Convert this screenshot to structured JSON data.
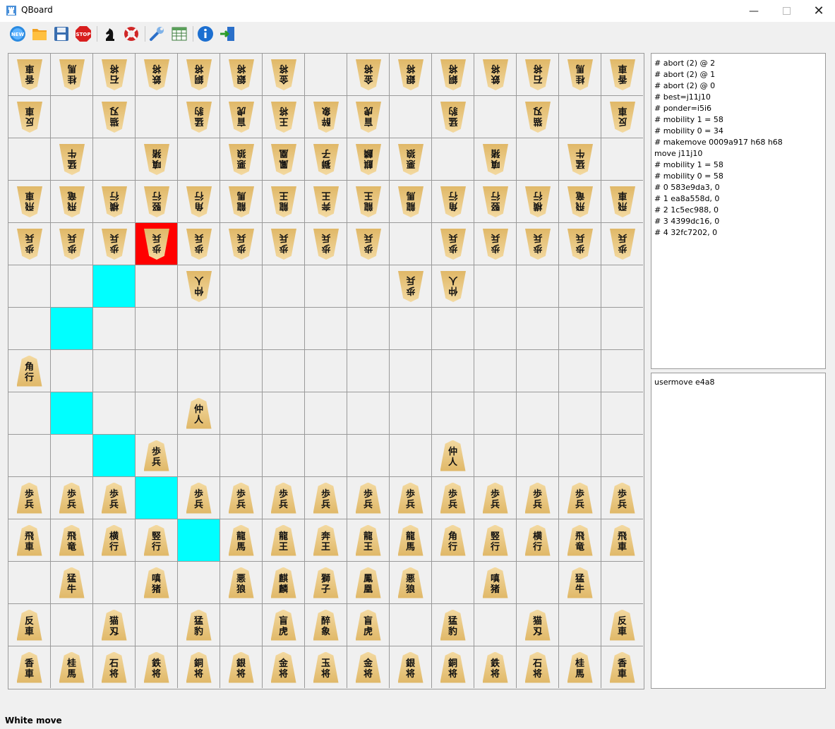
{
  "window": {
    "title": "QBoard"
  },
  "toolbar": {
    "buttons": [
      {
        "name": "new-game-button",
        "icon": "new-icon",
        "label": "NEW"
      },
      {
        "name": "open-button",
        "icon": "folder-icon"
      },
      {
        "name": "save-button",
        "icon": "floppy-icon"
      },
      {
        "name": "stop-button",
        "icon": "stop-icon",
        "label": "STOP"
      },
      {
        "name": "engine-button",
        "icon": "chess-knight-icon"
      },
      {
        "name": "help-button",
        "icon": "lifebuoy-icon"
      },
      {
        "name": "settings-button",
        "icon": "wrench-icon"
      },
      {
        "name": "table-button",
        "icon": "table-icon"
      },
      {
        "name": "about-button",
        "icon": "info-icon"
      },
      {
        "name": "exit-button",
        "icon": "exit-icon"
      }
    ]
  },
  "board": {
    "size": 15,
    "rows": [
      [
        [
          "香",
          "車",
          1
        ],
        [
          "桂",
          "馬",
          1
        ],
        [
          "石",
          "将",
          1
        ],
        [
          "鉄",
          "将",
          1
        ],
        [
          "銅",
          "将",
          1
        ],
        [
          "銀",
          "将",
          1
        ],
        [
          "金",
          "将",
          1
        ],
        null,
        [
          "金",
          "将",
          1
        ],
        [
          "銀",
          "将",
          1
        ],
        [
          "銅",
          "将",
          1
        ],
        [
          "鉄",
          "将",
          1
        ],
        [
          "石",
          "将",
          1
        ],
        [
          "桂",
          "馬",
          1
        ],
        [
          "香",
          "車",
          1
        ]
      ],
      [
        [
          "反",
          "車",
          1
        ],
        null,
        [
          "猫",
          "刄",
          1
        ],
        null,
        [
          "猛",
          "豹",
          1
        ],
        [
          "盲",
          "虎",
          1
        ],
        [
          "王",
          "将",
          1
        ],
        [
          "醉",
          "象",
          1
        ],
        [
          "盲",
          "虎",
          1
        ],
        null,
        [
          "猛",
          "豹",
          1
        ],
        null,
        [
          "猫",
          "刄",
          1
        ],
        null,
        [
          "反",
          "車",
          1
        ]
      ],
      [
        null,
        [
          "猛",
          "牛",
          1
        ],
        null,
        [
          "嗔",
          "猪",
          1
        ],
        null,
        [
          "悪",
          "狼",
          1
        ],
        [
          "鳳",
          "凰",
          1
        ],
        [
          "獅",
          "子",
          1
        ],
        [
          "麒",
          "麟",
          1
        ],
        [
          "悪",
          "狼",
          1
        ],
        null,
        [
          "嗔",
          "猪",
          1
        ],
        null,
        [
          "猛",
          "牛",
          1
        ],
        null
      ],
      [
        [
          "飛",
          "車",
          1
        ],
        [
          "飛",
          "竜",
          1
        ],
        [
          "横",
          "行",
          1
        ],
        [
          "竪",
          "行",
          1
        ],
        [
          "角",
          "行",
          1
        ],
        [
          "龍",
          "馬",
          1
        ],
        [
          "龍",
          "王",
          1
        ],
        [
          "奔",
          "王",
          1
        ],
        [
          "龍",
          "王",
          1
        ],
        [
          "龍",
          "馬",
          1
        ],
        [
          "角",
          "行",
          1
        ],
        [
          "竪",
          "行",
          1
        ],
        [
          "横",
          "行",
          1
        ],
        [
          "飛",
          "竜",
          1
        ],
        [
          "飛",
          "車",
          1
        ]
      ],
      [
        [
          "歩",
          "兵",
          1
        ],
        [
          "歩",
          "兵",
          1
        ],
        [
          "歩",
          "兵",
          1
        ],
        [
          "歩",
          "兵",
          1
        ],
        [
          "歩",
          "兵",
          1
        ],
        [
          "歩",
          "兵",
          1
        ],
        [
          "歩",
          "兵",
          1
        ],
        [
          "歩",
          "兵",
          1
        ],
        [
          "歩",
          "兵",
          1
        ],
        null,
        [
          "歩",
          "兵",
          1
        ],
        [
          "歩",
          "兵",
          1
        ],
        [
          "歩",
          "兵",
          1
        ],
        [
          "歩",
          "兵",
          1
        ],
        [
          "歩",
          "兵",
          1
        ]
      ],
      [
        null,
        null,
        null,
        null,
        [
          "仲",
          "人",
          1
        ],
        null,
        null,
        null,
        null,
        [
          "歩",
          "兵",
          1
        ],
        [
          "仲",
          "人",
          1
        ],
        null,
        null,
        null,
        null
      ],
      [
        null,
        null,
        null,
        null,
        null,
        null,
        null,
        null,
        null,
        null,
        null,
        null,
        null,
        null,
        null
      ],
      [
        [
          "角",
          "行",
          0
        ],
        null,
        null,
        null,
        null,
        null,
        null,
        null,
        null,
        null,
        null,
        null,
        null,
        null,
        null
      ],
      [
        null,
        null,
        null,
        null,
        [
          "仲",
          "人",
          0
        ],
        null,
        null,
        null,
        null,
        null,
        null,
        null,
        null,
        null,
        null
      ],
      [
        null,
        null,
        null,
        [
          "歩",
          "兵",
          0
        ],
        null,
        null,
        null,
        null,
        null,
        null,
        [
          "仲",
          "人",
          0
        ],
        null,
        null,
        null,
        null
      ],
      [
        [
          "歩",
          "兵",
          0
        ],
        [
          "歩",
          "兵",
          0
        ],
        [
          "歩",
          "兵",
          0
        ],
        null,
        [
          "歩",
          "兵",
          0
        ],
        [
          "歩",
          "兵",
          0
        ],
        [
          "歩",
          "兵",
          0
        ],
        [
          "歩",
          "兵",
          0
        ],
        [
          "歩",
          "兵",
          0
        ],
        [
          "歩",
          "兵",
          0
        ],
        [
          "歩",
          "兵",
          0
        ],
        [
          "歩",
          "兵",
          0
        ],
        [
          "歩",
          "兵",
          0
        ],
        [
          "歩",
          "兵",
          0
        ],
        [
          "歩",
          "兵",
          0
        ]
      ],
      [
        [
          "飛",
          "車",
          0
        ],
        [
          "飛",
          "竜",
          0
        ],
        [
          "横",
          "行",
          0
        ],
        [
          "竪",
          "行",
          0
        ],
        null,
        [
          "龍",
          "馬",
          0
        ],
        [
          "龍",
          "王",
          0
        ],
        [
          "奔",
          "王",
          0
        ],
        [
          "龍",
          "王",
          0
        ],
        [
          "龍",
          "馬",
          0
        ],
        [
          "角",
          "行",
          0
        ],
        [
          "竪",
          "行",
          0
        ],
        [
          "横",
          "行",
          0
        ],
        [
          "飛",
          "竜",
          0
        ],
        [
          "飛",
          "車",
          0
        ]
      ],
      [
        null,
        [
          "猛",
          "牛",
          0
        ],
        null,
        [
          "嗔",
          "猪",
          0
        ],
        null,
        [
          "悪",
          "狼",
          0
        ],
        [
          "麒",
          "麟",
          0
        ],
        [
          "獅",
          "子",
          0
        ],
        [
          "鳳",
          "凰",
          0
        ],
        [
          "悪",
          "狼",
          0
        ],
        null,
        [
          "嗔",
          "猪",
          0
        ],
        null,
        [
          "猛",
          "牛",
          0
        ],
        null
      ],
      [
        [
          "反",
          "車",
          0
        ],
        null,
        [
          "猫",
          "刄",
          0
        ],
        null,
        [
          "猛",
          "豹",
          0
        ],
        null,
        [
          "盲",
          "虎",
          0
        ],
        [
          "醉",
          "象",
          0
        ],
        [
          "盲",
          "虎",
          0
        ],
        null,
        [
          "猛",
          "豹",
          0
        ],
        null,
        [
          "猫",
          "刄",
          0
        ],
        null,
        [
          "反",
          "車",
          0
        ]
      ],
      [
        [
          "香",
          "車",
          0
        ],
        [
          "桂",
          "馬",
          0
        ],
        [
          "石",
          "将",
          0
        ],
        [
          "鉄",
          "将",
          0
        ],
        [
          "銅",
          "将",
          0
        ],
        [
          "銀",
          "将",
          0
        ],
        [
          "金",
          "将",
          0
        ],
        [
          "玉",
          "将",
          0
        ],
        [
          "金",
          "将",
          0
        ],
        [
          "銀",
          "将",
          0
        ],
        [
          "銅",
          "将",
          0
        ],
        [
          "鉄",
          "将",
          0
        ],
        [
          "石",
          "将",
          0
        ],
        [
          "桂",
          "馬",
          0
        ],
        [
          "香",
          "車",
          0
        ]
      ]
    ],
    "highlight_cells": [
      [
        5,
        2
      ],
      [
        6,
        1
      ],
      [
        8,
        1
      ],
      [
        9,
        2
      ],
      [
        10,
        3
      ],
      [
        11,
        4
      ]
    ],
    "selected_cell": [
      4,
      3
    ]
  },
  "engine_log": [
    "# abort (2) @ 2",
    "# abort (2) @ 1",
    "# abort (2) @ 0",
    "# best=j11j10",
    "# ponder=i5i6",
    "# mobility 1 = 58",
    "# mobility 0 = 34",
    "# makemove 0009a917 h68 h68",
    "move j11j10",
    "# mobility 1 = 58",
    "# mobility 0 = 58",
    "# 0 583e9da3, 0",
    "# 1 ea8a558d, 0",
    "# 2 1c5ec988, 0",
    "# 3 4399dc16, 0",
    "# 4 32fc7202, 0"
  ],
  "command_input": {
    "text": "usermove e4a8"
  },
  "status": {
    "text": "White move"
  }
}
